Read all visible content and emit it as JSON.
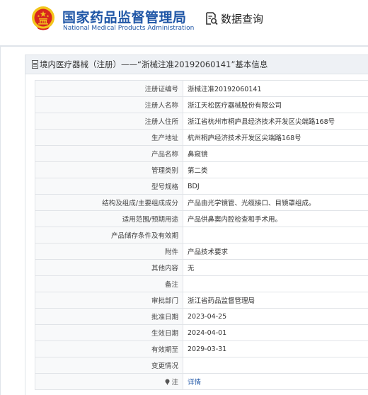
{
  "header": {
    "org_name_cn": "国家药品监督管理局",
    "org_name_en": "National Medical Products Administration",
    "query_label": "数据查询"
  },
  "panel": {
    "title": "境内医疗器械（注册）——“浙械注准20192060141”基本信息"
  },
  "rows": [
    {
      "label": "注册证编号",
      "value": "浙械注准20192060141"
    },
    {
      "label": "注册人名称",
      "value": "浙江天松医疗器械股份有限公司"
    },
    {
      "label": "注册人住所",
      "value": "浙江省杭州市桐庐县经济技术开发区尖端路168号"
    },
    {
      "label": "生产地址",
      "value": "杭州桐庐经济技术开发区尖端路168号"
    },
    {
      "label": "产品名称",
      "value": "鼻窥镜"
    },
    {
      "label": "管理类别",
      "value": "第二类"
    },
    {
      "label": "型号规格",
      "value": "BDJ"
    },
    {
      "label": "结构及组成/主要组成成分",
      "value": "产品由光学镜管、光缆接口、目镜罩组成。"
    },
    {
      "label": "适用范围/预期用途",
      "value": "产品供鼻窦内腔检查和手术用。"
    },
    {
      "label": "产品储存条件及有效期",
      "value": ""
    },
    {
      "label": "附件",
      "value": "产品技术要求"
    },
    {
      "label": "其他内容",
      "value": "无"
    },
    {
      "label": "备注",
      "value": ""
    },
    {
      "label": "审批部门",
      "value": "浙江省药品监督管理局"
    },
    {
      "label": "批准日期",
      "value": "2023-04-25"
    },
    {
      "label": "生效日期",
      "value": "2024-04-01"
    },
    {
      "label": "有效期至",
      "value": "2029-03-31"
    },
    {
      "label": "变更情况",
      "value": ""
    },
    {
      "label": "注",
      "value": "详情"
    }
  ],
  "colors": {
    "brand_blue": "#1f56a6",
    "emblem_red": "#d7261e",
    "emblem_gold": "#f3c51b"
  },
  "icons": {
    "emblem": "national-emblem-icon",
    "query": "document-search-icon",
    "title": "document-icon",
    "note": "note-icon"
  }
}
